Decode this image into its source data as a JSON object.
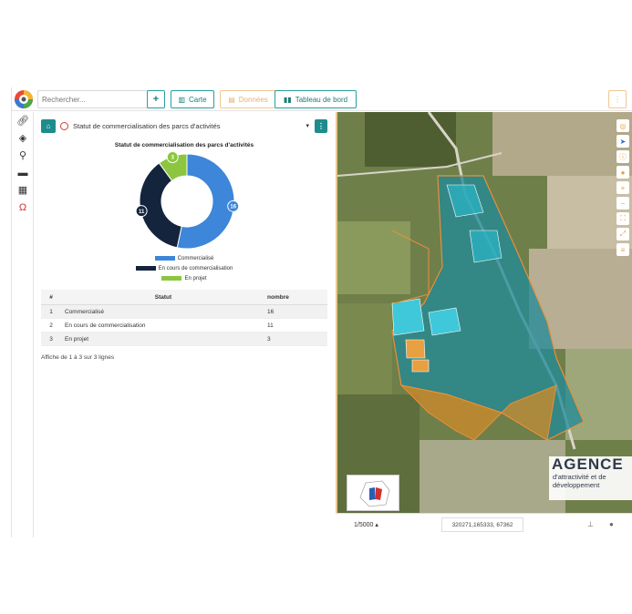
{
  "toolbar": {
    "search_placeholder": "Rechercher...",
    "plus_label": "+",
    "carte_label": "Carte",
    "donnees_label": "Données",
    "tableau_label": "Tableau de bord",
    "more_label": "⋮"
  },
  "sidebar": {
    "icons": [
      "link-icon",
      "layers-icon",
      "search-icon",
      "print-icon",
      "map-icon",
      "magnet-icon"
    ]
  },
  "panel": {
    "title": "Statut de commercialisation des parcs d'activités",
    "chart_title": "Statut de commercialisation des parcs d'activités"
  },
  "chart_data": {
    "type": "pie",
    "donut": true,
    "title": "Statut de commercialisation des parcs d'activités",
    "categories": [
      "Commercialisé",
      "En cours de commercialisation",
      "En projet"
    ],
    "values": [
      16,
      11,
      3
    ],
    "colors": [
      "#3d86d9",
      "#14243d",
      "#8cc63f"
    ],
    "legend_position": "bottom"
  },
  "table": {
    "headers": [
      "#",
      "Statut",
      "nombre"
    ],
    "rows": [
      [
        "1",
        "Commercialisé",
        "16"
      ],
      [
        "2",
        "En cours de commercialisation",
        "11"
      ],
      [
        "3",
        "En projet",
        "3"
      ]
    ],
    "footer": "Affiche de 1 à 3 sur 3 lignes"
  },
  "map": {
    "agence_title": "AGENCE",
    "agence_line1": "d'attractivité et de",
    "agence_line2": "développement"
  },
  "statusbar": {
    "scale": "1/5000",
    "coords": "320271,165333, 67362"
  },
  "colors": {
    "accent": "#1e8c8c",
    "orange": "#e8a040",
    "parcel_cyan": "#2ab7c9",
    "parcel_orange": "#c98a2a"
  }
}
